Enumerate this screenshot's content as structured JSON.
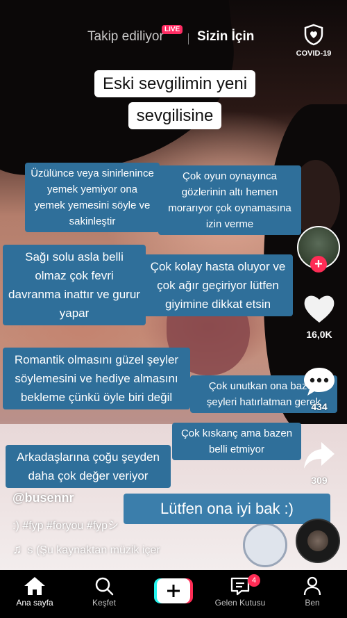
{
  "header": {
    "following_label": "Takip ediliyor",
    "live_badge": "LIVE",
    "for_you_label": "Sizin İçin",
    "covid_label": "COVID-19"
  },
  "video": {
    "title_overlay": "Eski sevgilimin yeni sevgilisine",
    "captions": [
      "Üzülünce veya sinirlenince yemek yemiyor ona yemek yemesini söyle ve sakinleştir",
      "Çok oyun oynayınca gözlerinin altı hemen morarıyor çok oynamasına izin verme",
      "Sağı solu asla belli olmaz çok fevri davranma inattır ve gurur yapar",
      "Çok kolay hasta oluyor ve çok ağır geçiriyor lütfen giyimine dikkat etsin",
      "Romantik olmasını güzel şeyler söylemesini ve hediye almasını bekleme çünkü öyle biri değil",
      "Çok unutkan ona bazen şeyleri hatırlatman gerek",
      "Çok kıskanç ama bazen belli etmiyor",
      "Arkadaşlarına çoğu şeyden daha çok değer veriyor",
      "Lütfen ona iyi bak :)"
    ]
  },
  "actions": {
    "likes": "16,0K",
    "comments": "434",
    "shares": "309"
  },
  "meta": {
    "username": "@busennr",
    "description": ":) #fyp #foryou #fypシ",
    "music": "s (Şu kaynaktan müzik içer"
  },
  "nav": {
    "home": "Ana sayfa",
    "discover": "Keşfet",
    "inbox": "Gelen Kutusu",
    "inbox_badge": "4",
    "profile": "Ben"
  },
  "colors": {
    "caption_bg": "#2f6f9a",
    "accent": "#fe2c55"
  }
}
